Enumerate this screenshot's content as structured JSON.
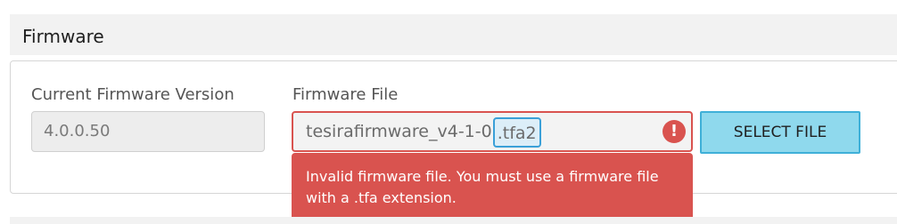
{
  "section": {
    "title": "Firmware"
  },
  "current_version": {
    "label": "Current Firmware Version",
    "value": "4.0.0.50"
  },
  "firmware_file": {
    "label": "Firmware File",
    "value_base": "tesirafirmware_v4-1-0",
    "value_extension": ".tfa2",
    "error_icon": "exclamation-circle-icon",
    "error_icon_glyph": "!",
    "error_message": "Invalid firmware file. You must use a firmware file with a .tfa extension."
  },
  "actions": {
    "select_file_label": "SELECT FILE"
  },
  "colors": {
    "error": "#d9534f",
    "button_bg": "#8fd9ed",
    "button_border": "#3fb0d8",
    "selection_border": "#3aa0d8",
    "header_bg": "#f2f2f2"
  }
}
